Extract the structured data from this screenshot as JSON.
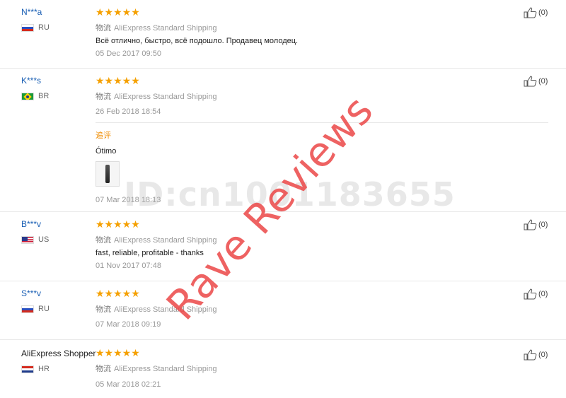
{
  "stars": "★★★★★",
  "like_icon": "thumbs-up-icon",
  "reviews": [
    {
      "user": "N***a",
      "country": "RU",
      "shipping_cn": "物流",
      "shipping": "AliExpress Standard Shipping",
      "text": "Всё отлично, быстро, всё подошло. Продавец молодец.",
      "date": "05 Dec 2017 09:50",
      "likes": "(0)"
    },
    {
      "user": "K***s",
      "country": "BR",
      "shipping_cn": "物流",
      "shipping": "AliExpress Standard Shipping",
      "date": "26 Feb 2018 18:54",
      "followup_label": "追评",
      "followup_text": "Ótimo",
      "followup_date": "07 Mar 2018 18:13",
      "likes": "(0)"
    },
    {
      "user": "B***v",
      "country": "US",
      "shipping_cn": "物流",
      "shipping": "AliExpress Standard Shipping",
      "text": "fast, reliable, profitable - thanks",
      "date": "01 Nov 2017 07:48",
      "likes": "(0)"
    },
    {
      "user": "S***v",
      "country": "RU",
      "shipping_cn": "物流",
      "shipping": "AliExpress Standard Shipping",
      "date": "07 Mar 2018 09:19",
      "likes": "(0)"
    },
    {
      "user": "AliExpress Shopper",
      "country": "HR",
      "shipping_cn": "物流",
      "shipping": "AliExpress Standard Shipping",
      "date": "05 Mar 2018 02:21",
      "likes": "(0)"
    }
  ],
  "watermarks": {
    "id": "ID:cn1001183655",
    "rave": "Rave Reviews"
  },
  "colors": {
    "star": "#f5a000",
    "username": "#1a5fb4",
    "followup": "#f08c00",
    "watermark_red": "#eb4646"
  }
}
